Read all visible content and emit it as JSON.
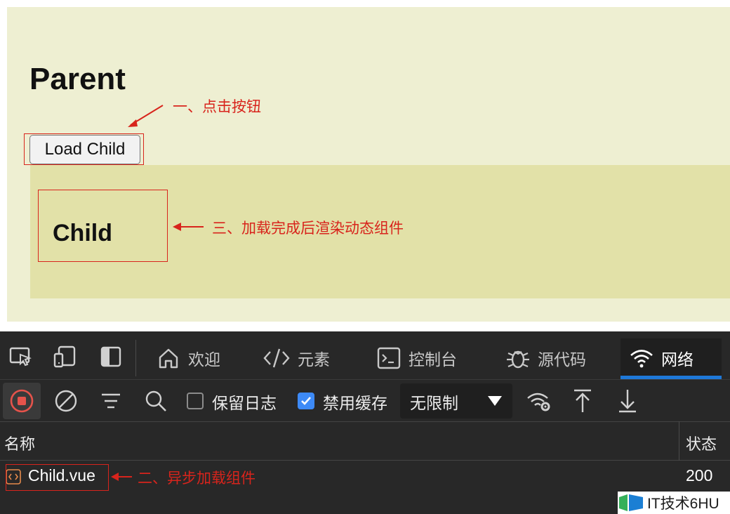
{
  "page": {
    "parent_title": "Parent",
    "load_button": "Load Child",
    "child_title": "Child",
    "annotations": {
      "step1": "一、点击按钮",
      "step2": "二、异步加载组件",
      "step3": "三、加载完成后渲染动态组件"
    }
  },
  "devtools": {
    "tabs": [
      {
        "label": "欢迎",
        "icon": "home-icon"
      },
      {
        "label": "元素",
        "icon": "code-icon"
      },
      {
        "label": "控制台",
        "icon": "console-icon"
      },
      {
        "label": "源代码",
        "icon": "bug-icon"
      },
      {
        "label": "网络",
        "icon": "wifi-icon",
        "active": true
      }
    ],
    "toolbar": {
      "preserve_log": "保留日志",
      "preserve_log_checked": false,
      "disable_cache": "禁用缓存",
      "disable_cache_checked": true,
      "throttle": "无限制"
    },
    "table": {
      "columns": [
        "名称",
        "状态"
      ],
      "rows": [
        {
          "name": "Child.vue",
          "status": "200"
        }
      ]
    }
  },
  "watermark": {
    "text": "IT技术6HU"
  },
  "colors": {
    "parent_bg": "#eeefd2",
    "child_bg": "#e2e1a8",
    "annotation": "#d8241c",
    "devtools_bg": "#282828",
    "active_tab_underline": "#1e78d7"
  }
}
